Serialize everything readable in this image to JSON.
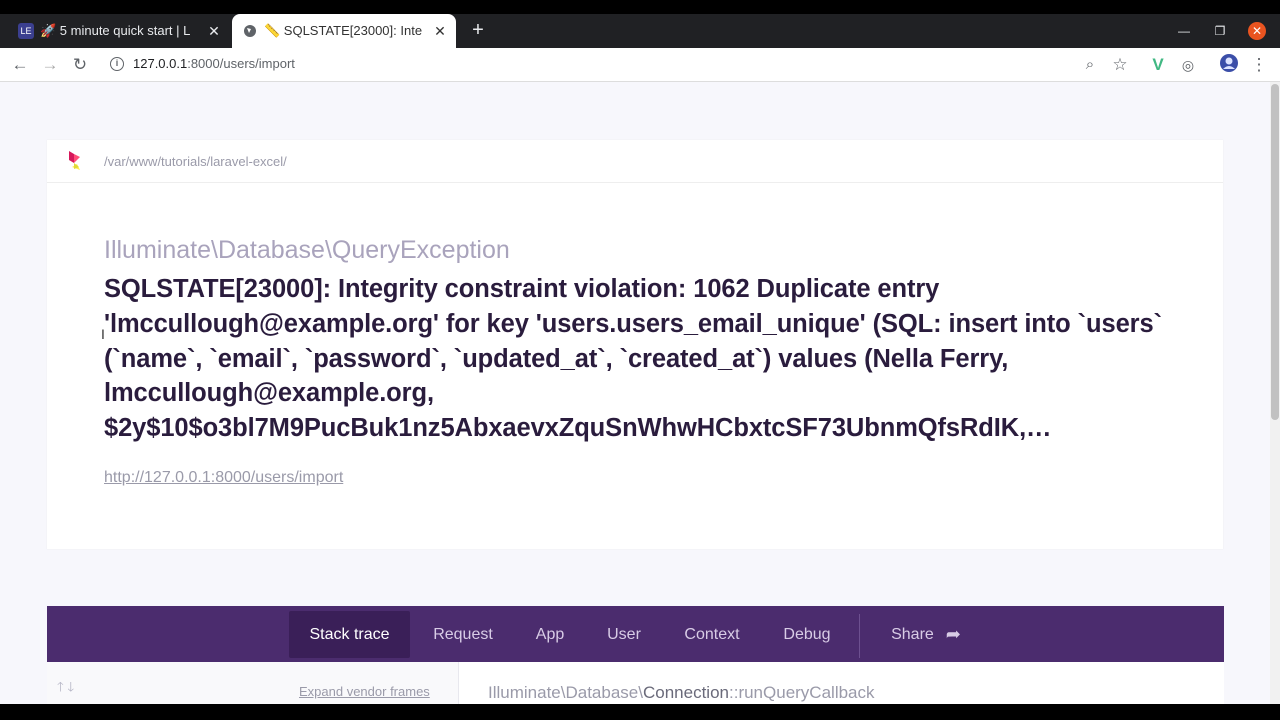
{
  "browser": {
    "tabs": [
      {
        "favicon": "LE",
        "title": "🚀 5 minute quick start | L",
        "active": false
      },
      {
        "favicon": "globe",
        "title": "📏 SQLSTATE[23000]: Inte",
        "active": true
      }
    ],
    "new_tab": "+",
    "url_host": "127.0.0.1",
    "url_path": ":8000/users/import"
  },
  "ignition": {
    "app_path": "/var/www/tutorials/laravel-excel/",
    "exception_class": "Illuminate\\Database\\QueryException",
    "exception_message": "SQLSTATE[23000]: Integrity constraint violation: 1062 Duplicate entry 'lmccullough@example.org' for key 'users.users_email_unique' (SQL: insert into `users` (`name`, `email`, `password`, `updated_at`, `created_at`) values (Nella Ferry, lmccullough@example.org, $2y$10$o3bl7M9PucBuk1nz5AbxaevxZquSnWhwHCbxtcSF73UbnmQfsRdIK,…",
    "request_url": "http://127.0.0.1:8000/users/import",
    "tabs": [
      "Stack trace",
      "Request",
      "App",
      "User",
      "Context",
      "Debug"
    ],
    "share_label": "Share",
    "expand_vendor_frames": "Expand vendor frames",
    "frame_namespace": "Illuminate\\Database\\",
    "frame_class": "Connection",
    "frame_method": "::runQueryCallback"
  },
  "colors": {
    "tab_bar": "#202124",
    "ignition_purple": "#4b2c6e",
    "ignition_purple_active": "#3a1f58",
    "message_text": "#2a1c3d",
    "ubuntu_close": "#e95420"
  }
}
